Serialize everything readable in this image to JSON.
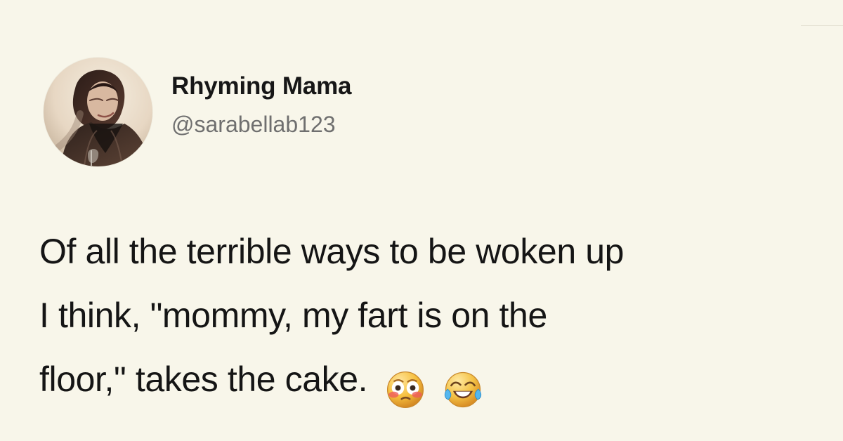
{
  "tweet": {
    "author": {
      "display_name": "Rhyming Mama",
      "handle": "@sarabellab123",
      "avatar_icon": "profile-photo"
    },
    "text_lines": [
      "Of all the terrible ways to be woken up",
      "I think, \"mommy, my fart is on the",
      "floor,\" takes the cake."
    ],
    "emojis": [
      "flushed-face-emoji",
      "face-with-tears-of-joy-emoji"
    ]
  },
  "colors": {
    "background": "#f8f6ea",
    "text": "#151515",
    "handle": "#6f6f6f"
  }
}
